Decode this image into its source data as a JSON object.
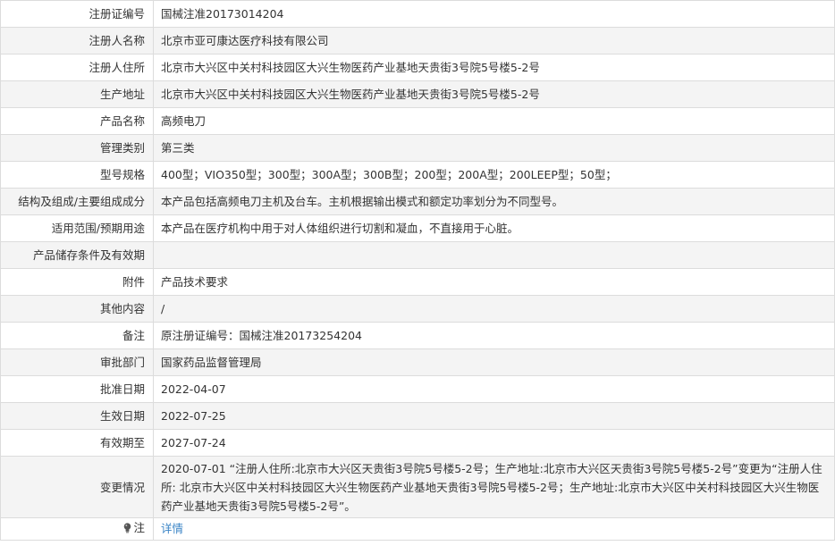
{
  "rows": [
    {
      "label": "注册证编号",
      "value": "国械注准20173014204"
    },
    {
      "label": "注册人名称",
      "value": "北京市亚可康达医疗科技有限公司"
    },
    {
      "label": "注册人住所",
      "value": "北京市大兴区中关村科技园区大兴生物医药产业基地天贵街3号院5号楼5-2号"
    },
    {
      "label": "生产地址",
      "value": "北京市大兴区中关村科技园区大兴生物医药产业基地天贵街3号院5号楼5-2号"
    },
    {
      "label": "产品名称",
      "value": "高频电刀"
    },
    {
      "label": "管理类别",
      "value": "第三类"
    },
    {
      "label": "型号规格",
      "value": "400型；VIO350型；300型；300A型；300B型；200型；200A型；200LEEP型；50型；"
    },
    {
      "label": "结构及组成/主要组成成分",
      "value": "本产品包括高频电刀主机及台车。主机根据输出模式和额定功率划分为不同型号。"
    },
    {
      "label": "适用范围/预期用途",
      "value": "本产品在医疗机构中用于对人体组织进行切割和凝血，不直接用于心脏。"
    },
    {
      "label": "产品储存条件及有效期",
      "value": ""
    },
    {
      "label": "附件",
      "value": "产品技术要求"
    },
    {
      "label": "其他内容",
      "value": "/"
    },
    {
      "label": "备注",
      "value": "原注册证编号：国械注准20173254204"
    },
    {
      "label": "审批部门",
      "value": "国家药品监督管理局"
    },
    {
      "label": "批准日期",
      "value": "2022-04-07"
    },
    {
      "label": "生效日期",
      "value": "2022-07-25"
    },
    {
      "label": "有效期至",
      "value": "2027-07-24"
    },
    {
      "label": "变更情况",
      "value": "2020-07-01 “注册人住所:北京市大兴区天贵街3号院5号楼5-2号；生产地址:北京市大兴区天贵街3号院5号楼5-2号”变更为“注册人住所: 北京市大兴区中关村科技园区大兴生物医药产业基地天贵街3号院5号楼5-2号；生产地址:北京市大兴区中关村科技园区大兴生物医药产业基地天贵街3号院5号楼5-2号”。"
    }
  ],
  "note": {
    "label": "注",
    "icon": "lightbulb-icon",
    "link_text": "详情",
    "link_color": "#3a84c6"
  }
}
